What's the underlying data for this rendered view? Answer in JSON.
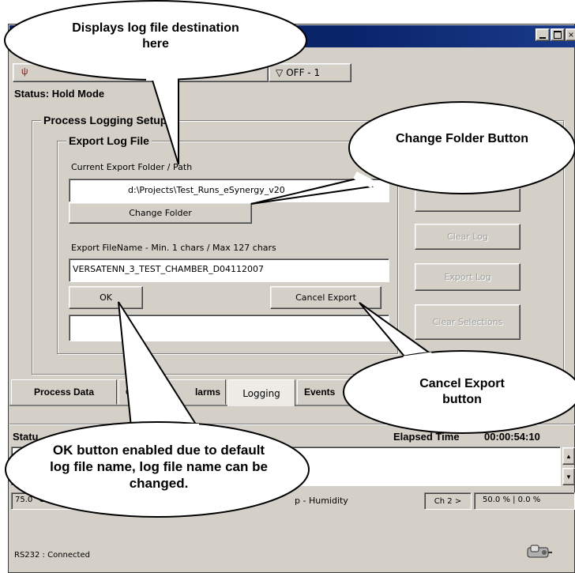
{
  "window": {
    "title": "",
    "tabs": [
      "OFF - 1"
    ],
    "status_label": "Status:",
    "status_value": "Hold Mode"
  },
  "logging_group": {
    "title": "Process Logging Setup",
    "export_group_title": "Export Log File",
    "folder_label": "Current Export Folder / Path",
    "folder_value": "d:\\Projects\\Test_Runs_eSynergy_v20",
    "change_folder_label": "Change Folder",
    "filename_label": "Export FileName - Min. 1 chars / Max 127 chars",
    "filename_value": "VERSATENN_3_TEST_CHAMBER_D04112007",
    "ok_label": "OK",
    "cancel_export_label": "Cancel Export",
    "message_value": "",
    "side_buttons": [
      "Clear Log",
      "Export Log",
      "Clear Selections"
    ]
  },
  "bottom_tabs": [
    "Process Data",
    "G",
    "larms",
    "Logging",
    "Events"
  ],
  "status_panel": {
    "label": "Statu",
    "elapsed_label": "Elapsed Time",
    "elapsed_value": "00:00:54:10"
  },
  "channels": {
    "ch1_value": "75.0 °C",
    "ch1_name": "p - Humidity",
    "ch2_button": "Ch 2 >",
    "ch2_value": "50.0 % | 0.0 %"
  },
  "footer": {
    "connection": "RS232 : Connected"
  },
  "callouts": {
    "folder_display": "Displays log  file destination here",
    "change_folder": "Change Folder Button",
    "cancel_export": "Cancel Export button",
    "ok_enabled": "OK button enabled due to default log file name, log file name can be changed."
  },
  "colors": {
    "window_face": "#d4d0c8",
    "titlebar": "#0a246a",
    "callout_fill": "#ffffff"
  }
}
